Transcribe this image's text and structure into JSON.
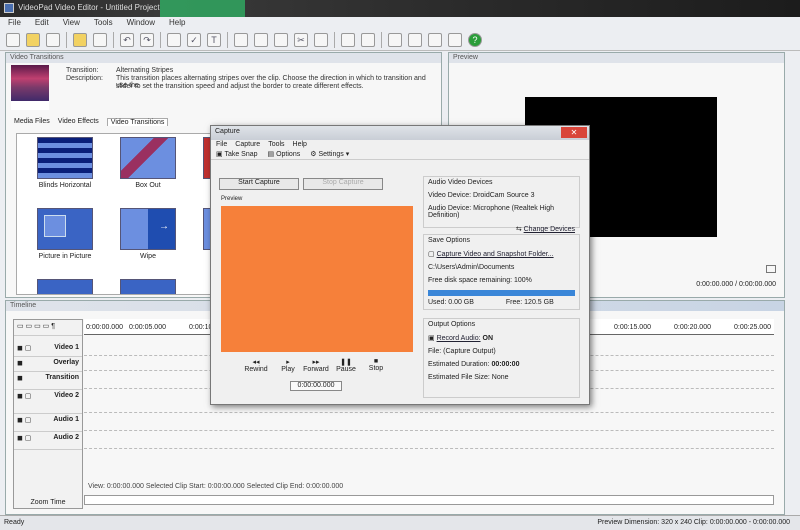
{
  "window": {
    "title": "VideoPad Video Editor - Untitled Project"
  },
  "menu": [
    "File",
    "Edit",
    "View",
    "Tools",
    "Window",
    "Help"
  ],
  "media_panel": {
    "title": "Video Transitions",
    "name_label": "Transition:",
    "name_value": "Alternating Stripes",
    "desc_label": "Description:",
    "desc_value": "This transition places alternating stripes over the clip. Choose the direction in which to transition and use the",
    "desc_value2": "slider to set the transition speed and adjust the border to create different effects.",
    "tabs": [
      "Media Files",
      "Video Effects",
      "Video Transitions"
    ],
    "tiles": [
      "Blinds Horizontal",
      "Box Out",
      "Picture in Picture",
      "Wipe"
    ]
  },
  "preview": {
    "title": "Preview",
    "timecode": "0:00:00.000 / 0:00:00.000"
  },
  "timeline": {
    "title": "Timeline",
    "tracks": [
      "Video 1",
      "Overlay",
      "Transition",
      "Video 2",
      "Audio 1",
      "Audio 2"
    ],
    "ruler": [
      "0:00:00.000",
      "0:00:05.000",
      "0:00:10.000",
      "0:00:15.000",
      "0:00:20.000",
      "0:00:25.000"
    ],
    "zoom_label": "Zoom Time",
    "bottom": "View: 0:00:00.000   Selected Clip Start: 0:00:00.000   Selected Clip End: 0:00:00.000"
  },
  "status": {
    "left": "Ready",
    "right": "Preview Dimension: 320 x 240    Clip: 0:00:00.000 - 0:00:00.000"
  },
  "capture": {
    "title": "Capture",
    "menu": [
      "File",
      "Capture",
      "Tools",
      "Help"
    ],
    "toolbar": [
      "Take Snap",
      "Options",
      "Settings"
    ],
    "start_button": "Start Capture",
    "stop_button": "Stop Capture",
    "preview_label": "Preview",
    "controls": [
      "Rewind",
      "Play",
      "Forward",
      "Pause",
      "Stop"
    ],
    "timecode": "0:00:00.000",
    "devices": {
      "title": "Audio Video Devices",
      "video": "Video Device: DroidCam Source 3",
      "audio": "Audio Device: Microphone (Realtek High Definition)",
      "change": "Change Devices"
    },
    "save": {
      "title": "Save Options",
      "link": "Capture Video and Snapshot Folder...",
      "path": "C:\\Users\\Admin\\Documents",
      "free": "Free disk space remaining: 100%",
      "progress": 100,
      "used": "Used: 0.00 GB",
      "free2": "Free: 120.5 GB"
    },
    "output": {
      "title": "Output Options",
      "record": "Record Audio:",
      "record_val": "ON",
      "file": "File: (Capture Output)",
      "dur_label": "Estimated Duration:",
      "dur_val": "00:00:00",
      "size": "Estimated File Size: None"
    }
  },
  "colors": {
    "preview_fill": "#f6803a",
    "accent": "#3a86d8"
  }
}
